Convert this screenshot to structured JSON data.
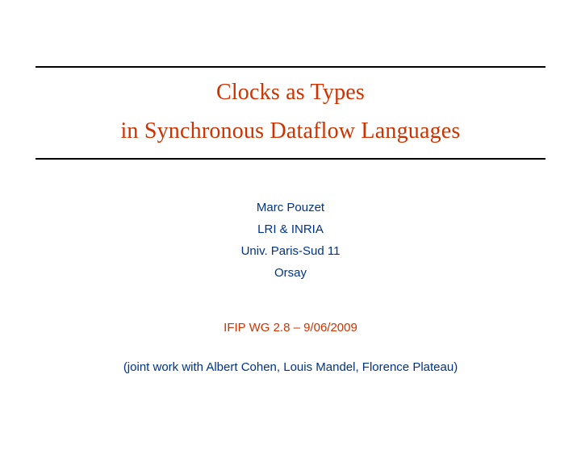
{
  "title": {
    "line1": "Clocks as Types",
    "line2": "in Synchronous Dataflow Languages"
  },
  "author": {
    "name": "Marc Pouzet",
    "affiliation1": "LRI & INRIA",
    "affiliation2": "Univ. Paris-Sud 11",
    "location": "Orsay"
  },
  "event": "IFIP WG 2.8 – 9/06/2009",
  "joint_work": "(joint work with Albert Cohen, Louis Mandel, Florence Plateau)"
}
